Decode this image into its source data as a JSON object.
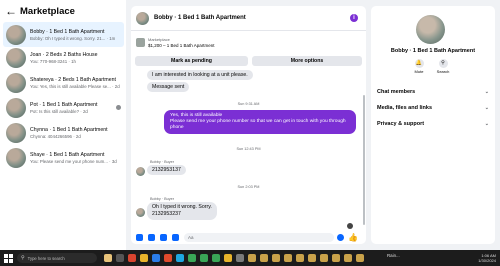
{
  "app": {
    "title": "Marketplace"
  },
  "conversations": [
    {
      "name": "Bobby · 1 Bed 1 Bath Apartment",
      "preview": "Bobby: Oh I typed it wrong. Sorry. 21... · 1m",
      "active": true
    },
    {
      "name": "Joan · 2 Beds 2 Baths House",
      "preview": "You: 770-968-3241 · 1h",
      "active": false
    },
    {
      "name": "Shatereya · 2 Beds 1 Bath Apartment",
      "preview": "You: Yes, this is still available Please se... · 2d",
      "active": false
    },
    {
      "name": "Pot · 1 Bed 1 Bath Apartment",
      "preview": "Pot: Is this still available? · 2d",
      "active": false
    },
    {
      "name": "Chynna · 1 Bed 1 Bath Apartment",
      "preview": "Chynna: 4044266596 · 2d",
      "active": false
    },
    {
      "name": "Shaye · 1 Bed 1 Bath Apartment",
      "preview": "You: Please send me your phone num... · 3d",
      "active": false
    }
  ],
  "chat": {
    "title": "Bobby · 1 Bed 1 Bath Apartment",
    "listing_kind": "Marketplace",
    "listing_name": "$1,200 – 1 Bed 1 Bath Apartment",
    "mark_pending": "Mark as pending",
    "more_options": "More options",
    "messages": {
      "m1": "I am interested in looking at a unit please.",
      "m2": "Message sent",
      "ts1": "Sun 9:31 AM",
      "out1a": "Yes, this is still available",
      "out1b": "Please send me your phone number so that we can get in touch with you through phone",
      "ts2": "Sun 12:43 PM",
      "sender1": "Bobby · Buyer",
      "m3": "2132953137",
      "ts3": "Sun 2:03 PM",
      "sender2": "Bobby · Buyer",
      "m4a": "Oh I typed it wrong. Sorry.",
      "m4b": "2132953237"
    },
    "composer_placeholder": "Aa"
  },
  "details": {
    "name": "Bobby · 1 Bed 1 Bath Apartment",
    "mute": "Mute",
    "search": "Search",
    "rows": [
      "Chat members",
      "Media, files and links",
      "Privacy & support"
    ]
  },
  "taskbar": {
    "search": "Type here to search",
    "weather": "Rain...",
    "time": "1:06 AM",
    "date": "1/30/2024"
  },
  "colors": {
    "accent": "#7b2fd4",
    "blue": "#0866ff",
    "active_row": "#e7f3ff"
  }
}
